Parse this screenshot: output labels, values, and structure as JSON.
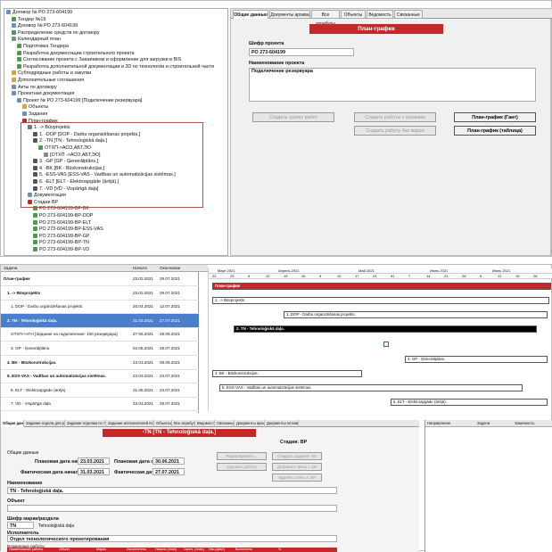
{
  "tree": {
    "items": [
      "Договор № РО 273-604199",
      "Тендер №19",
      "Договор № РО 273-604199",
      "Распределение средств по договору",
      "Календарный план",
      "Подготовка Тендера",
      "Разработка документации строительного проекта",
      "Согласование проекта с Заказчиком и оформление для загрузки в BIS",
      "Разработка дополнительной документации и 3D по технологии и строительной части",
      "Субподрядные работы и закупки",
      "Дополнительные соглашения",
      "Акты по договору",
      "Проектная документация",
      "Проект № РО 273-604199 [Подключение резервуара]",
      "Объекты",
      "Задания",
      "План-график",
      "1. -> Būvprojekts",
      "1. -DOP [DOP - Darbu organizēšanas projekts.]",
      "2. -TN [TN - Tehnoloģiskā daļa.]",
      "ОТХП->АСО,АБТ,ЭО",
      "[ОТХП ->АСО,АБТ,ЭО]",
      "3. -GP [GP - Ģenerālplāns.]",
      "4. -BK [BK - Būvkonstrukcijas.]",
      "5. -ESS-VAS [ESS-VAS - Vadības un automatizācijas sistēmas.]",
      "6. -ELT [ELT - Elektroapgāde (ārējā).]",
      "7. -VD [VD - Vispārīgā daļa]",
      "Документация",
      "Стадии ВР",
      "РО 273-604199-ВР-ВК",
      "РО 273-604199-ВР-DOP",
      "РО 273-604199-ВР-ELT",
      "РО 273-604199-ВР-ESS-VAS",
      "РО 273-604199-ВР-GP",
      "РО 273-604199-ВР-TN",
      "РО 273-604199-ВР-VD"
    ]
  },
  "right": {
    "tabs": [
      "Общие данные",
      "Документы архива",
      "Все атрибуты",
      "Объекты",
      "Ведомость",
      "Связанные"
    ],
    "title": "План-график",
    "cipher_label": "Шифр проекта",
    "cipher_value": "РО 273-604199",
    "name_label": "Наименование проекта",
    "name_value": "Подключение резервуара",
    "btn_group": "Создать группу работ",
    "btn_mark": "Создать работы с марками",
    "btn_nomark": "Создать работу без марки",
    "btn_gantt": "План-график (Гант)",
    "btn_table": "План-график (таблица)"
  },
  "grid": {
    "headers": [
      "Задача",
      "Начало",
      "Окончание"
    ],
    "rows": [
      {
        "task": "План-график",
        "start": "23.03.2021",
        "end": "29.07.2021"
      },
      {
        "task": "1. -> Būvprojekts",
        "start": "23.03.2021",
        "end": "29.07.2021"
      },
      {
        "task": "1. DOP - Darbu organizēšanas projekts.",
        "start": "20.04.2021",
        "end": "12.07.2021"
      },
      {
        "task": "2. TN - Tehnoloģiskā daļa.",
        "start": "31.03.2021",
        "end": "27.07.2021"
      },
      {
        "task": "ОТХП->АТН [Задание на подключение: 100 резервуара]",
        "start": "27.05.2021",
        "end": "28.05.2021"
      },
      {
        "task": "3. GP - Ģenerālplāns.",
        "start": "04.06.2021",
        "end": "28.07.2021"
      },
      {
        "task": "4. BK - Būvkonstrukcijas.",
        "start": "23.03.2021",
        "end": "08.06.2021"
      },
      {
        "task": "5. ESS-VAS - Vadības un automatizācijas sistēmas.",
        "start": "23.03.2021",
        "end": "23.07.2021"
      },
      {
        "task": "6. ELT - Elektroapgāde (ārējā).",
        "start": "31.05.2021",
        "end": "23.07.2021"
      },
      {
        "task": "7. VD - Vispārīgā daļa",
        "start": "23.03.2021",
        "end": "29.07.2021"
      }
    ]
  },
  "gantt": {
    "months": [
      "Март 2021",
      "Апрель 2021",
      "Май 2021",
      "Июнь 2021",
      "Июль 2021"
    ],
    "days": [
      "22",
      "29",
      "5",
      "12",
      "19",
      "26",
      "3",
      "10",
      "17",
      "24",
      "31",
      "7",
      "14",
      "21",
      "28",
      "5",
      "12",
      "19",
      "26"
    ],
    "bars": [
      "План-график",
      "1. -> Būvprojekts",
      "1. DOP - Darbu organizēšanas projekts.",
      "2. TN - Tehnoloģiskā daļa.",
      "3. GP - Ģenerālplāns.",
      "4. BK - Būvkonstrukcijas.",
      "5. ESS-VAS - Vadības un automatizācijas sistēmas.",
      "6. ELT - Elektroapgāde (ārējā)."
    ]
  },
  "bottom": {
    "tabs": [
      "Общие данные",
      "Задание отдела для работы",
      "Задание отделам по текущей работе",
      "Задание исполнителей по текущей работе",
      "Объекты",
      "Все атрибуты",
      "Ведомость",
      "Связанные",
      "Документы архива",
      "Документы потомков"
    ],
    "title": "-TN [TN - Tehnoloģiskā daļa.]",
    "stage_label": "Стадия: ВР",
    "general": "Общие данные",
    "plan_start_label": "Плановая дата начала",
    "plan_start": "23.03.2021",
    "plan_end_label": "Плановая дата оконч.",
    "plan_end": "30.06.2021",
    "fact_start_label": "Фактическая дата начала",
    "fact_start": "31.03.2021",
    "fact_end_label": "Фактическая дата оконч.",
    "fact_end": "27.07.2021",
    "btn_edit": "Редактировать...",
    "btn_delete": "Удалить работу",
    "btn_create_task": "Создать задание ЗИ",
    "btn_add_link": "Добавить связь с ЗИ",
    "btn_del_link": "Удалить связь с ЗИ",
    "name_label": "Наименование",
    "name_value": "TN - Tehnoloģiskā daļa.",
    "object_label": "Объект",
    "cipher_label": "Шифр марки/раздела",
    "cipher_value": "TN",
    "cipher_desc": "Tehnoloģiskā daļa",
    "exec_label": "Исполнитель",
    "exec_value": "Отдел технологического проектирования",
    "nested_label": "Вложенные работы",
    "nested_headers": [
      "Наименование работы",
      "Объект",
      "Марка",
      "Исполнитель",
      "Начало (план)",
      "Оконч. (план)",
      "Нач.(факт)",
      "Выполнено",
      "%"
    ],
    "rside_headers": [
      "Направление",
      "Задача",
      "Замечкость"
    ]
  }
}
